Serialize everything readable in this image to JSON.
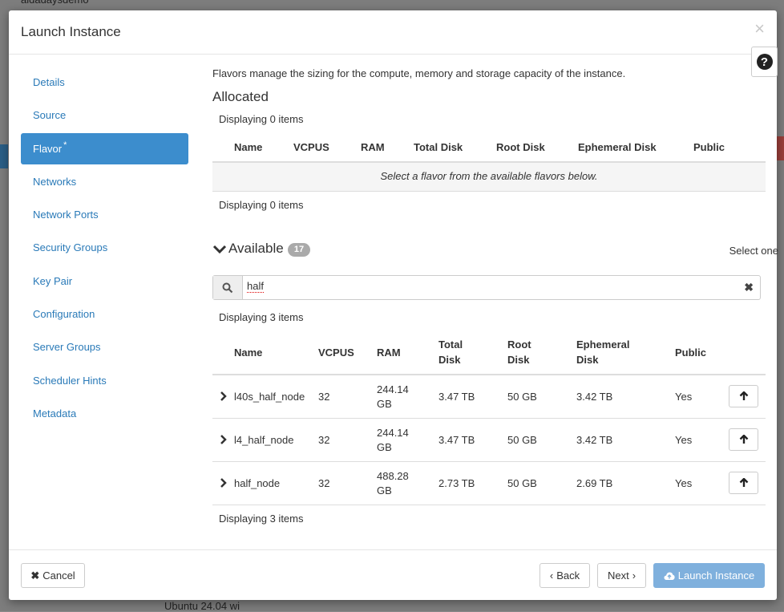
{
  "background": {
    "project_text": "aidadaysdemo",
    "bottom_text": "Ubuntu 24.04 wi"
  },
  "modal": {
    "title": "Launch Instance",
    "close_glyph": "×",
    "help_glyph": "?"
  },
  "sidebar": {
    "items": [
      {
        "label": "Details",
        "active": false
      },
      {
        "label": "Source",
        "active": false
      },
      {
        "label": "Flavor",
        "active": true,
        "required_mark": "*"
      },
      {
        "label": "Networks",
        "active": false
      },
      {
        "label": "Network Ports",
        "active": false
      },
      {
        "label": "Security Groups",
        "active": false
      },
      {
        "label": "Key Pair",
        "active": false
      },
      {
        "label": "Configuration",
        "active": false
      },
      {
        "label": "Server Groups",
        "active": false
      },
      {
        "label": "Scheduler Hints",
        "active": false
      },
      {
        "label": "Metadata",
        "active": false
      }
    ]
  },
  "flavor": {
    "description": "Flavors manage the sizing for the compute, memory and storage capacity of the instance.",
    "allocated": {
      "title": "Allocated",
      "count_top": "Displaying 0 items",
      "columns": [
        "Name",
        "VCPUS",
        "RAM",
        "Total Disk",
        "Root Disk",
        "Ephemeral Disk",
        "Public"
      ],
      "empty_message": "Select a flavor from the available flavors below.",
      "count_bottom": "Displaying 0 items"
    },
    "available": {
      "title": "Available",
      "badge": "17",
      "select_hint": "Select one",
      "search_value": "half",
      "count_top": "Displaying 3 items",
      "columns": [
        {
          "line1": "Name",
          "line2": ""
        },
        {
          "line1": "VCPUS",
          "line2": ""
        },
        {
          "line1": "RAM",
          "line2": ""
        },
        {
          "line1": "Total",
          "line2": "Disk"
        },
        {
          "line1": "Root",
          "line2": "Disk"
        },
        {
          "line1": "Ephemeral",
          "line2": "Disk"
        },
        {
          "line1": "Public",
          "line2": ""
        }
      ],
      "rows": [
        {
          "name": "l40s_half_node",
          "vcpus": "32",
          "ram_1": "244.14",
          "ram_2": "GB",
          "total_disk": "3.47 TB",
          "root_disk": "50 GB",
          "ephemeral_disk": "3.42 TB",
          "public": "Yes"
        },
        {
          "name": "l4_half_node",
          "vcpus": "32",
          "ram_1": "244.14",
          "ram_2": "GB",
          "total_disk": "3.47 TB",
          "root_disk": "50 GB",
          "ephemeral_disk": "3.42 TB",
          "public": "Yes"
        },
        {
          "name": "half_node",
          "vcpus": "32",
          "ram_1": "488.28",
          "ram_2": "GB",
          "total_disk": "2.73 TB",
          "root_disk": "50 GB",
          "ephemeral_disk": "2.69 TB",
          "public": "Yes"
        }
      ],
      "count_bottom": "Displaying 3 items"
    }
  },
  "footer": {
    "cancel_label": "Cancel",
    "back_label": "Back",
    "next_label": "Next",
    "launch_label": "Launch Instance"
  }
}
